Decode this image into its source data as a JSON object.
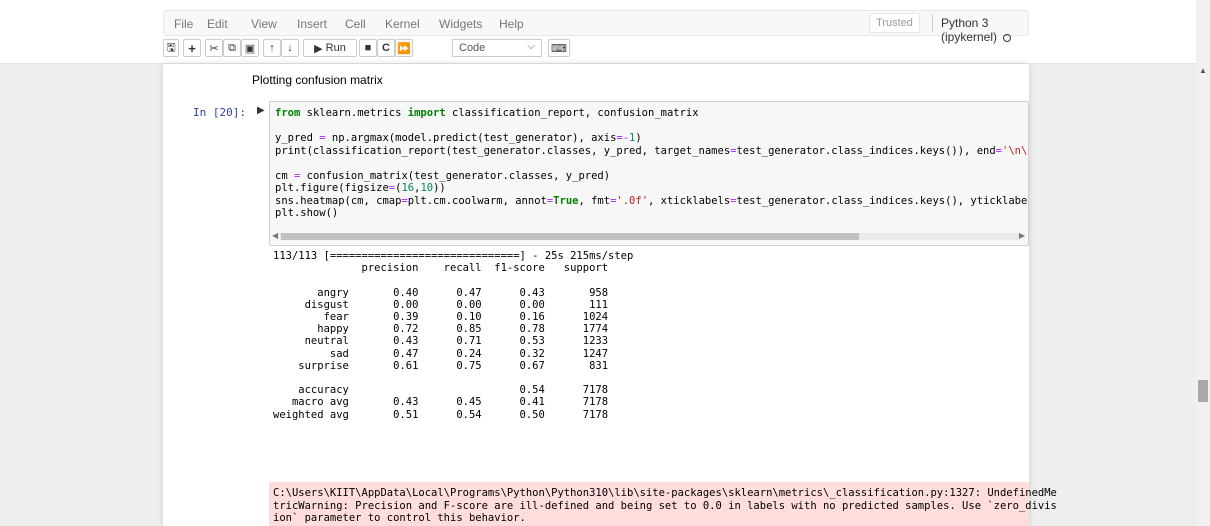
{
  "menu": {
    "file": "File",
    "edit": "Edit",
    "view": "View",
    "insert": "Insert",
    "cell": "Cell",
    "kernel": "Kernel",
    "widgets": "Widgets",
    "help": "Help"
  },
  "status": {
    "trusted": "Trusted",
    "kernel_name": "Python 3 (ipykernel)"
  },
  "toolbar": {
    "run_label": "Run",
    "cell_type": "Code"
  },
  "cells": {
    "markdown_text": "Plotting confusion matrix",
    "prompt": "In [20]:"
  },
  "stderr_text": "C:\\Users\\KIIT\\AppData\\Local\\Programs\\Python\\Python310\\lib\\site-packages\\sklearn\\metrics\\_classification.py:1327: UndefinedMe\ntricWarning: Precision and F-score are ill-defined and being set to 0.0 in labels with no predicted samples. Use `zero_divis\nion` parameter to control this behavior.",
  "output_text": "113/113 [==============================] - 25s 215ms/step\n              precision    recall  f1-score   support\n\n       angry       0.40      0.47      0.43       958\n     disgust       0.00      0.00      0.00       111\n        fear       0.39      0.10      0.16      1024\n       happy       0.72      0.85      0.78      1774\n     neutral       0.43      0.71      0.53      1233\n         sad       0.47      0.24      0.32      1247\n    surprise       0.61      0.75      0.67       831\n\n    accuracy                           0.54      7178\n   macro avg       0.43      0.45      0.41      7178\nweighted avg       0.51      0.54      0.50      7178"
}
